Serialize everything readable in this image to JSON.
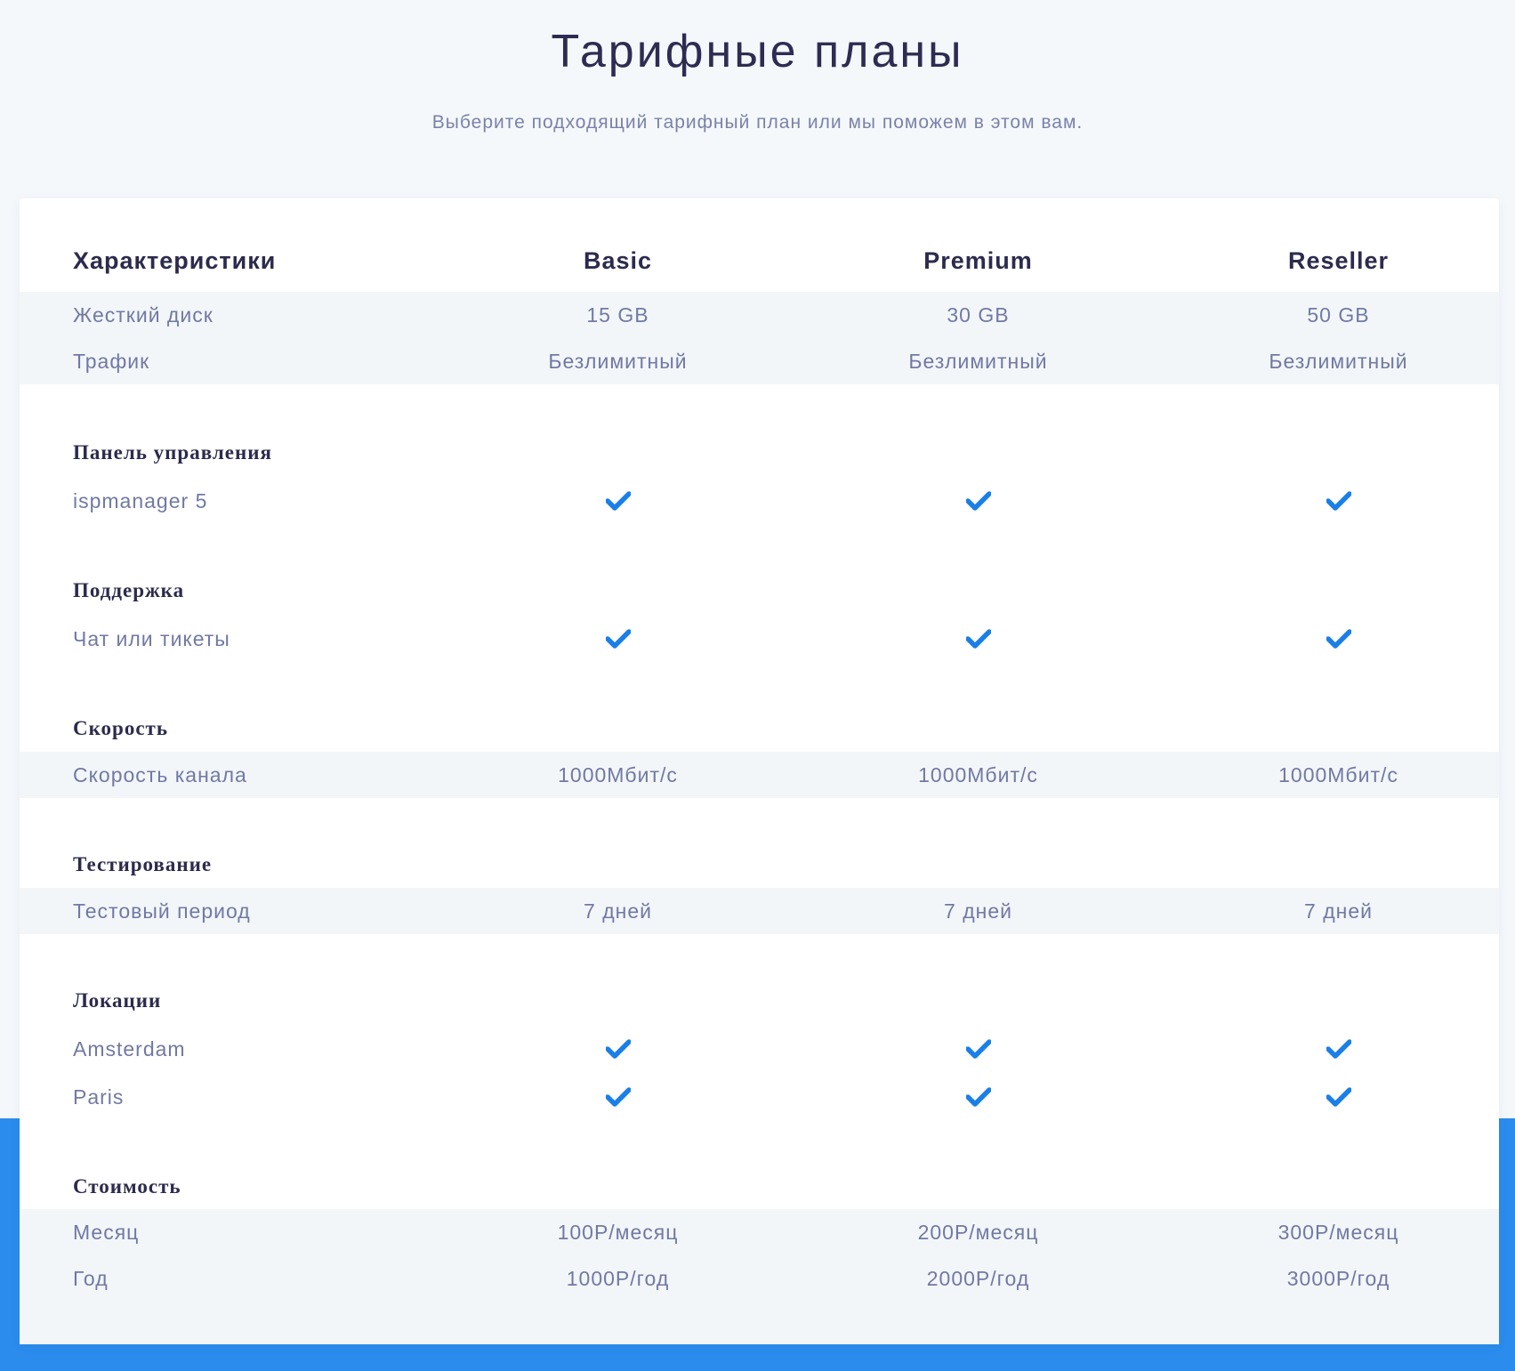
{
  "page": {
    "title": "Тарифные планы",
    "subtitle": "Выберите подходящий тарифный план или мы поможем в этом вам."
  },
  "colors": {
    "accent": "#2b8ced",
    "check": "#1a7fe8",
    "row_band": "#f3f6f9"
  },
  "table": {
    "header": [
      "Характеристики",
      "Basic",
      "Premium",
      "Reseller"
    ],
    "rows": {
      "disk": [
        "Жесткий диск",
        "15 GB",
        "30 GB",
        "50 GB"
      ],
      "traffic": [
        "Трафик",
        "Безлимитный",
        "Безлимитный",
        "Безлимитный"
      ],
      "panel": [
        "ispmanager 5",
        "check-icon",
        "check-icon",
        "check-icon"
      ],
      "support": [
        "Чат или тикеты",
        "check-icon",
        "check-icon",
        "check-icon"
      ],
      "speed": [
        "Скорость канала",
        "1000Мбит/с",
        "1000Мбит/с",
        "1000Мбит/с"
      ],
      "trial": [
        "Тестовый период",
        "7 дней",
        "7 дней",
        "7 дней"
      ],
      "amsterdam": [
        "Amsterdam",
        "check-icon",
        "check-icon",
        "check-icon"
      ],
      "paris": [
        "Paris",
        "check-icon",
        "check-icon",
        "check-icon"
      ],
      "month": [
        "Месяц",
        "100Р/месяц",
        "200Р/месяц",
        "300Р/месяц"
      ],
      "year": [
        "Год",
        "1000Р/год",
        "2000Р/год",
        "3000Р/год"
      ]
    },
    "sections": {
      "panel": "Панель управления",
      "support": "Поддержка",
      "speed": "Скорость",
      "testing": "Тестирование",
      "locations": "Локации",
      "price": "Стоимость"
    }
  }
}
